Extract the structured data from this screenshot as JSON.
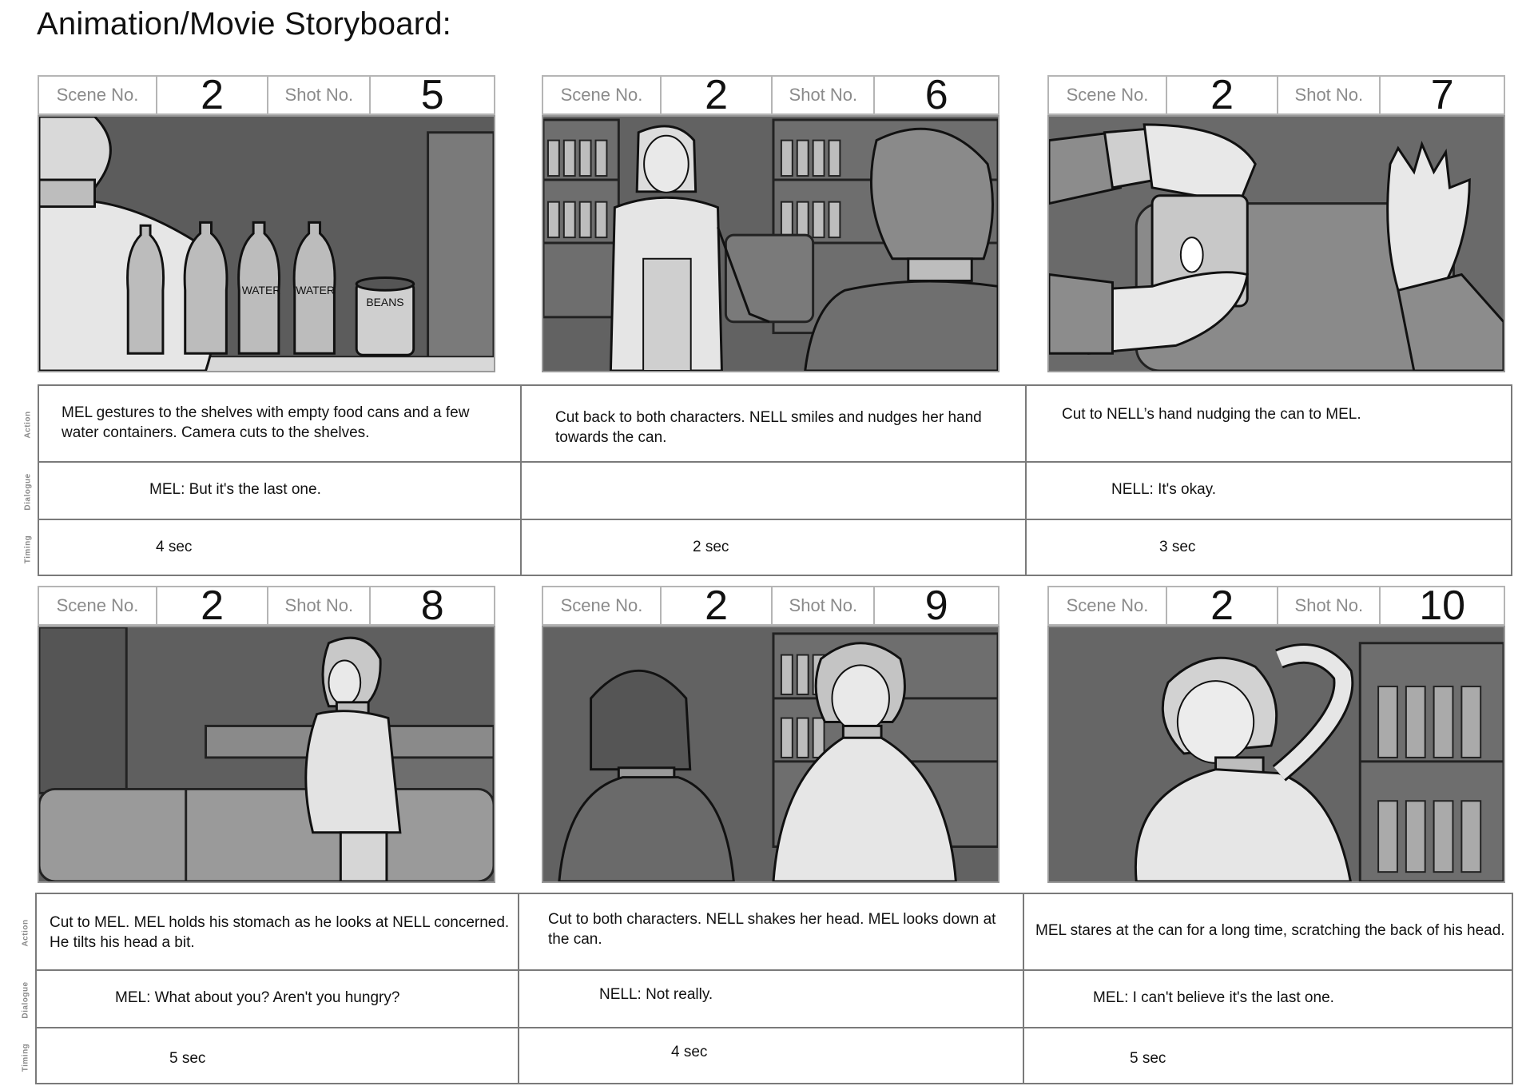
{
  "page": {
    "title": "Animation/Movie Storyboard:"
  },
  "labels": {
    "scene": "Scene No.",
    "shot": "Shot No.",
    "row_action": "Action",
    "row_dialogue": "Dialogue",
    "row_timing": "Timing"
  },
  "panels": [
    {
      "scene": "2",
      "shot": "5",
      "action": "MEL gestures to the shelves with empty food cans and a few water containers. Camera cuts to the shelves.",
      "dialogue": "MEL: But it's the last one.",
      "timing": "4 sec",
      "art": {
        "bottle_text": "WATER",
        "can_text": "BEANS"
      }
    },
    {
      "scene": "2",
      "shot": "6",
      "action": "Cut back to both characters. NELL smiles and nudges her hand towards the can.",
      "dialogue": "",
      "timing": "2 sec"
    },
    {
      "scene": "2",
      "shot": "7",
      "action": "Cut to NELL’s hand nudging the can to MEL.",
      "dialogue": "NELL: It's okay.",
      "timing": "3 sec"
    },
    {
      "scene": "2",
      "shot": "8",
      "action": "Cut to MEL. MEL holds his stomach as he looks at NELL concerned. He tilts his head a bit.",
      "dialogue": "MEL: What about you?  Aren't you hungry?",
      "timing": "5 sec"
    },
    {
      "scene": "2",
      "shot": "9",
      "action": "Cut to both characters. NELL shakes her head. MEL looks down at the can.",
      "dialogue": "NELL: Not really.",
      "timing": "4 sec"
    },
    {
      "scene": "2",
      "shot": "10",
      "action": "MEL stares at the can for a long time, scratching the back of his head.",
      "dialogue": "MEL: I can't believe it's the last one.",
      "timing": "5 sec"
    }
  ]
}
